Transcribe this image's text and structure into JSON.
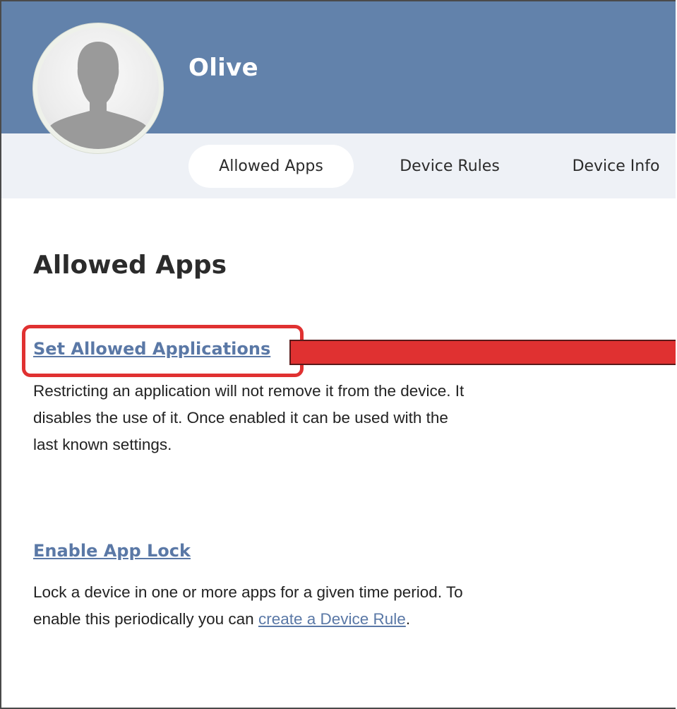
{
  "profile": {
    "name": "Olive",
    "avatar_icon": "person-silhouette-icon"
  },
  "tabs": [
    {
      "label": "Allowed Apps",
      "active": true
    },
    {
      "label": "Device Rules",
      "active": false
    },
    {
      "label": "Device Info",
      "active": false
    }
  ],
  "main": {
    "title": "Allowed Apps",
    "sections": [
      {
        "link": "Set Allowed Applications",
        "description": "Restricting an application will not remove it from the device. It disables the use of it. Once enabled it can be used with the last known settings."
      },
      {
        "link": "Enable App Lock",
        "description_prefix": "Lock a device in one or more apps for a given time period. To enable this periodically you can ",
        "description_link": "create a Device Rule",
        "description_suffix": "."
      }
    ]
  },
  "colors": {
    "header": "#6282ab",
    "tabbar": "#eef1f6",
    "link": "#5a78a6",
    "highlight": "#e03131"
  }
}
